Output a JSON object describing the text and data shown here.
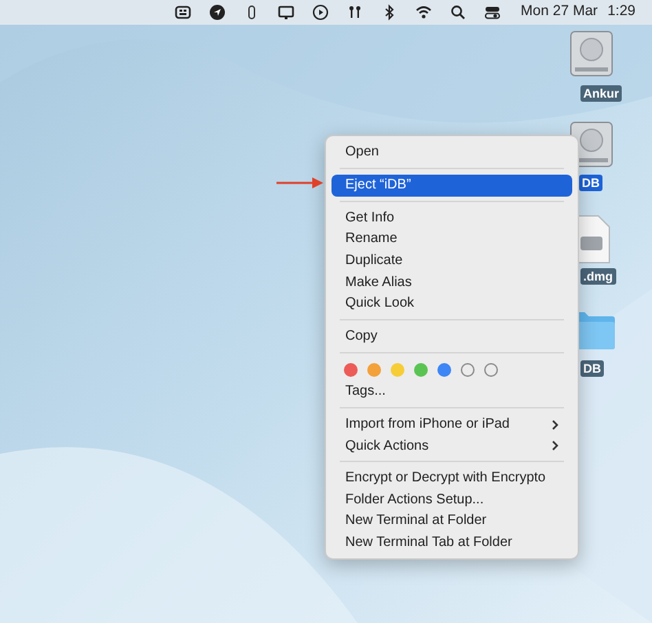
{
  "menu_bar": {
    "date": "Mon 27 Mar",
    "time": "1:29"
  },
  "desktop_icons": [
    {
      "kind": "disk",
      "label": "Ankur",
      "selected": false
    },
    {
      "kind": "disk",
      "label": "DB",
      "selected": true
    },
    {
      "kind": "file",
      "label": ".dmg",
      "selected": false
    },
    {
      "kind": "folder",
      "label": "DB",
      "selected": false
    }
  ],
  "context_menu": {
    "sections": [
      [
        {
          "kind": "item",
          "label": "Open",
          "selected": false
        }
      ],
      [
        {
          "kind": "item",
          "label": "Eject “iDB”",
          "selected": true
        }
      ],
      [
        {
          "kind": "item",
          "label": "Get Info",
          "selected": false
        },
        {
          "kind": "item",
          "label": "Rename",
          "selected": false
        },
        {
          "kind": "item",
          "label": "Duplicate",
          "selected": false
        },
        {
          "kind": "item",
          "label": "Make Alias",
          "selected": false
        },
        {
          "kind": "item",
          "label": "Quick Look",
          "selected": false
        }
      ],
      [
        {
          "kind": "item",
          "label": "Copy",
          "selected": false
        }
      ],
      [
        {
          "kind": "tags",
          "tags": [
            {
              "kind": "filled",
              "color": "#ec5b57"
            },
            {
              "kind": "filled",
              "color": "#f3a13b"
            },
            {
              "kind": "filled",
              "color": "#f6cd37"
            },
            {
              "kind": "filled",
              "color": "#5ac452"
            },
            {
              "kind": "filled",
              "color": "#3d86f5"
            },
            {
              "kind": "empty"
            },
            {
              "kind": "empty"
            }
          ]
        },
        {
          "kind": "item",
          "label": "Tags...",
          "selected": false
        }
      ],
      [
        {
          "kind": "submenu",
          "label": "Import from iPhone or iPad",
          "selected": false
        },
        {
          "kind": "submenu",
          "label": "Quick Actions",
          "selected": false
        }
      ],
      [
        {
          "kind": "item",
          "label": "Encrypt or Decrypt with Encrypto",
          "selected": false
        },
        {
          "kind": "item",
          "label": "Folder Actions Setup...",
          "selected": false
        },
        {
          "kind": "item",
          "label": "New Terminal at Folder",
          "selected": false
        },
        {
          "kind": "item",
          "label": "New Terminal Tab at Folder",
          "selected": false
        }
      ]
    ]
  },
  "annotation": {
    "kind": "arrow"
  }
}
